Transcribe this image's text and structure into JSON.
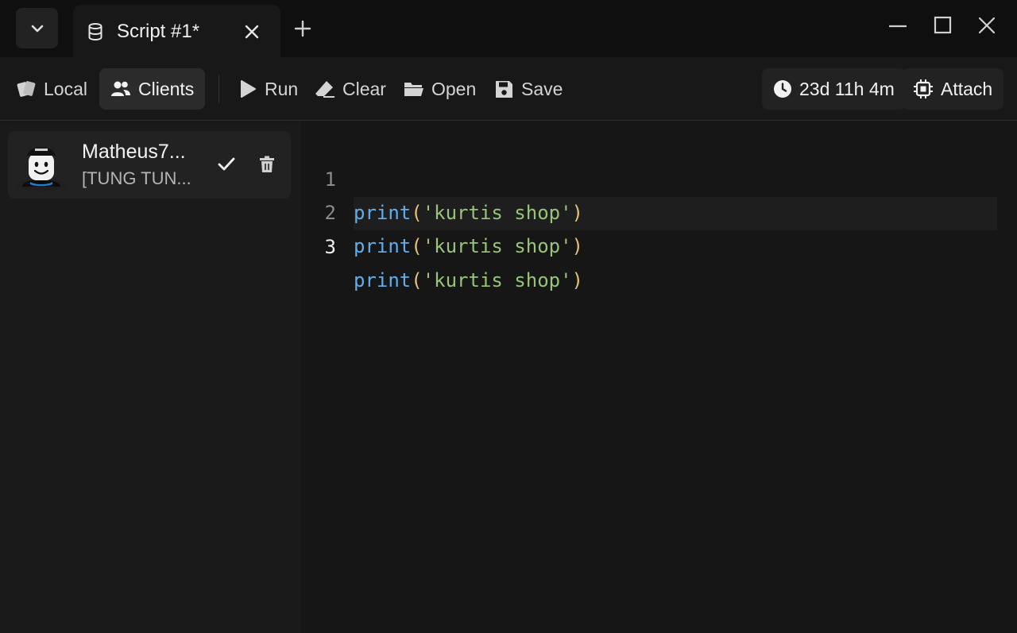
{
  "titlebar": {
    "tab": {
      "title": "Script #1*"
    }
  },
  "toolbar": {
    "local_label": "Local",
    "clients_label": "Clients",
    "run_label": "Run",
    "clear_label": "Clear",
    "open_label": "Open",
    "save_label": "Save",
    "timer": "23d 11h 4m",
    "attach_label": "Attach"
  },
  "sidebar": {
    "clients": [
      {
        "name": "Matheus7...",
        "game": "[TUNG TUN..."
      }
    ]
  },
  "editor": {
    "active_line": 3,
    "lines": [
      {
        "number": "1",
        "fn": "print",
        "open": "(",
        "str": "'kurtis shop'",
        "close": ")"
      },
      {
        "number": "2",
        "fn": "print",
        "open": "(",
        "str": "'kurtis shop'",
        "close": ")"
      },
      {
        "number": "3",
        "fn": "print",
        "open": "(",
        "str": "'kurtis shop'",
        "close": ")"
      }
    ]
  },
  "colors": {
    "background": "#171717",
    "titlebar": "#0f0f0f",
    "keyword_fn": "#61aeee",
    "string": "#98c379",
    "paren": "#e5c07b"
  },
  "icons": [
    "chevron-down-icon",
    "database-icon",
    "close-icon",
    "plus-icon",
    "minimize-icon",
    "maximize-icon",
    "cards-icon",
    "users-icon",
    "play-icon",
    "eraser-icon",
    "folder-icon",
    "floppy-icon",
    "clock-icon",
    "chip-icon",
    "check-icon",
    "trash-icon"
  ]
}
